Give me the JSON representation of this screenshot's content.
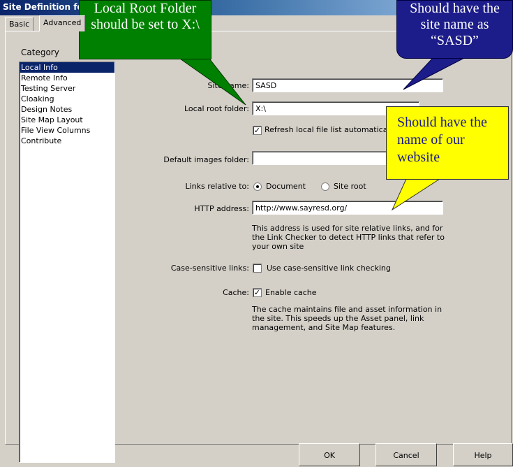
{
  "window": {
    "title": "Site Definition fo"
  },
  "tabs": [
    {
      "label": "Basic"
    },
    {
      "label": "Advanced"
    }
  ],
  "category": {
    "label": "Category",
    "items": [
      {
        "label": "Local Info"
      },
      {
        "label": "Remote Info"
      },
      {
        "label": "Testing Server"
      },
      {
        "label": "Cloaking"
      },
      {
        "label": "Design Notes"
      },
      {
        "label": "Site Map Layout"
      },
      {
        "label": "File View Columns"
      },
      {
        "label": "Contribute"
      }
    ]
  },
  "form": {
    "site_name_label": "Site name:",
    "site_name_value": "SASD",
    "local_root_label": "Local root folder:",
    "local_root_value": "X:\\",
    "refresh_label": "Refresh local file list automatically",
    "default_images_label": "Default images folder:",
    "default_images_value": "",
    "links_relative_label": "Links relative to:",
    "document_label": "Document",
    "site_root_label": "Site root",
    "http_label": "HTTP address:",
    "http_value": "http://www.sayresd.org/",
    "http_desc": "This address is used for site relative links, and for the Link Checker to detect HTTP links that refer to your own site",
    "case_label": "Case-sensitive links:",
    "case_checkbox_label": "Use case-sensitive link checking",
    "cache_label": "Cache:",
    "cache_checkbox_label": "Enable cache",
    "cache_desc": "The cache maintains file and asset information in the site.  This speeds up the Asset panel, link management, and Site Map features."
  },
  "buttons": {
    "ok": "OK",
    "cancel": "Cancel",
    "help": "Help"
  },
  "callouts": {
    "green": "Local Root Folder should be set to X:\\",
    "blue": "Should have the site name as “SASD”",
    "yellow": "Should have the name of our website"
  },
  "colors": {
    "selection": "#0a246a",
    "green_callout": "#008000",
    "blue_callout": "#1c1c8a",
    "yellow_callout": "#ffff00"
  }
}
